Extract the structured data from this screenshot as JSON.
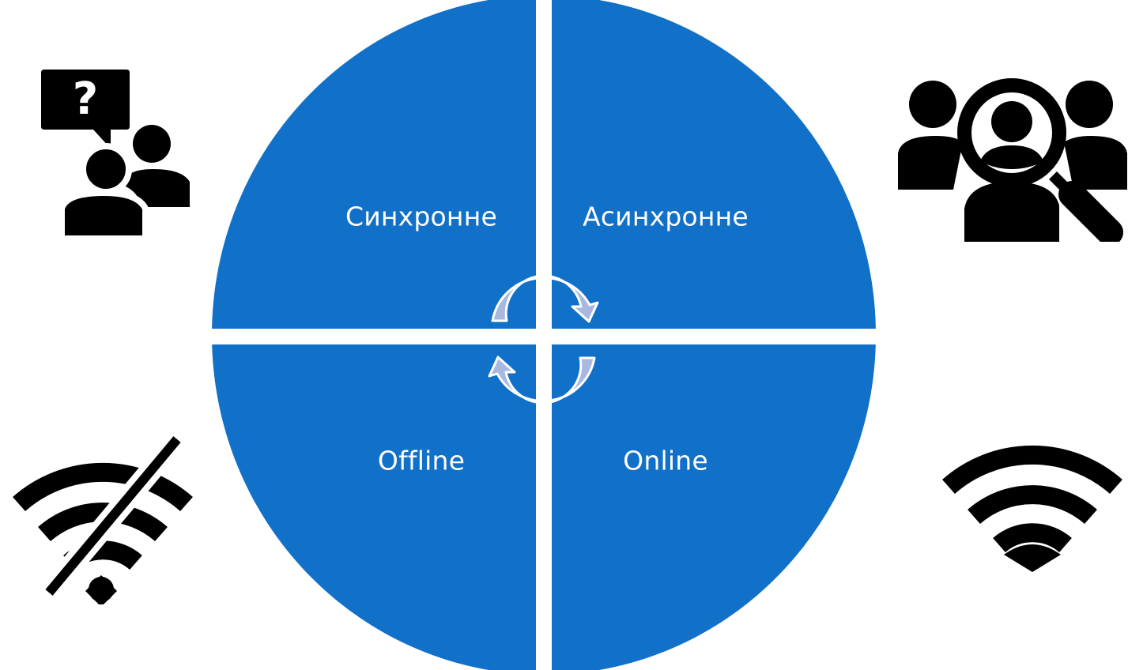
{
  "colors": {
    "quadrant_fill": "#1170C8",
    "divider": "#ffffff",
    "arrow_fill": "#A9B8DF",
    "arrow_stroke": "#ffffff",
    "icon_fill": "#000000",
    "label_text": "#ffffff"
  },
  "quadrants": {
    "top_left": {
      "label": "Синхронне"
    },
    "top_right": {
      "label": "Асинхронне"
    },
    "bottom_left": {
      "label": "Offline"
    },
    "bottom_right": {
      "label": "Online"
    }
  },
  "icons": {
    "top_left": "question-people-icon",
    "top_right": "people-search-icon",
    "bottom_left": "wifi-off-icon",
    "bottom_right": "wifi-icon",
    "center": "cycle-arrows-icon"
  }
}
